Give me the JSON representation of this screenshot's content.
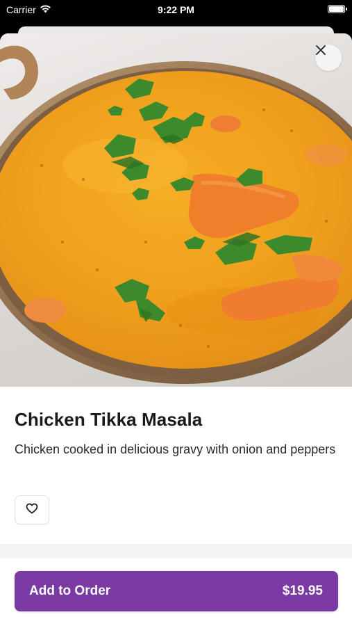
{
  "status_bar": {
    "carrier": "Carrier",
    "time": "9:22 PM"
  },
  "item": {
    "title": "Chicken Tikka Masala",
    "description": "Chicken cooked in delicious gravy with onion and peppers",
    "image_alt": "chicken-tikka-masala-photo"
  },
  "actions": {
    "close_icon": "close-icon",
    "favorite_icon": "heart-icon",
    "add_to_order_label": "Add to Order",
    "price": "$19.95"
  },
  "colors": {
    "accent": "#7b3aa3",
    "text_primary": "#1a1a1a",
    "curry": "#f0a21e"
  }
}
